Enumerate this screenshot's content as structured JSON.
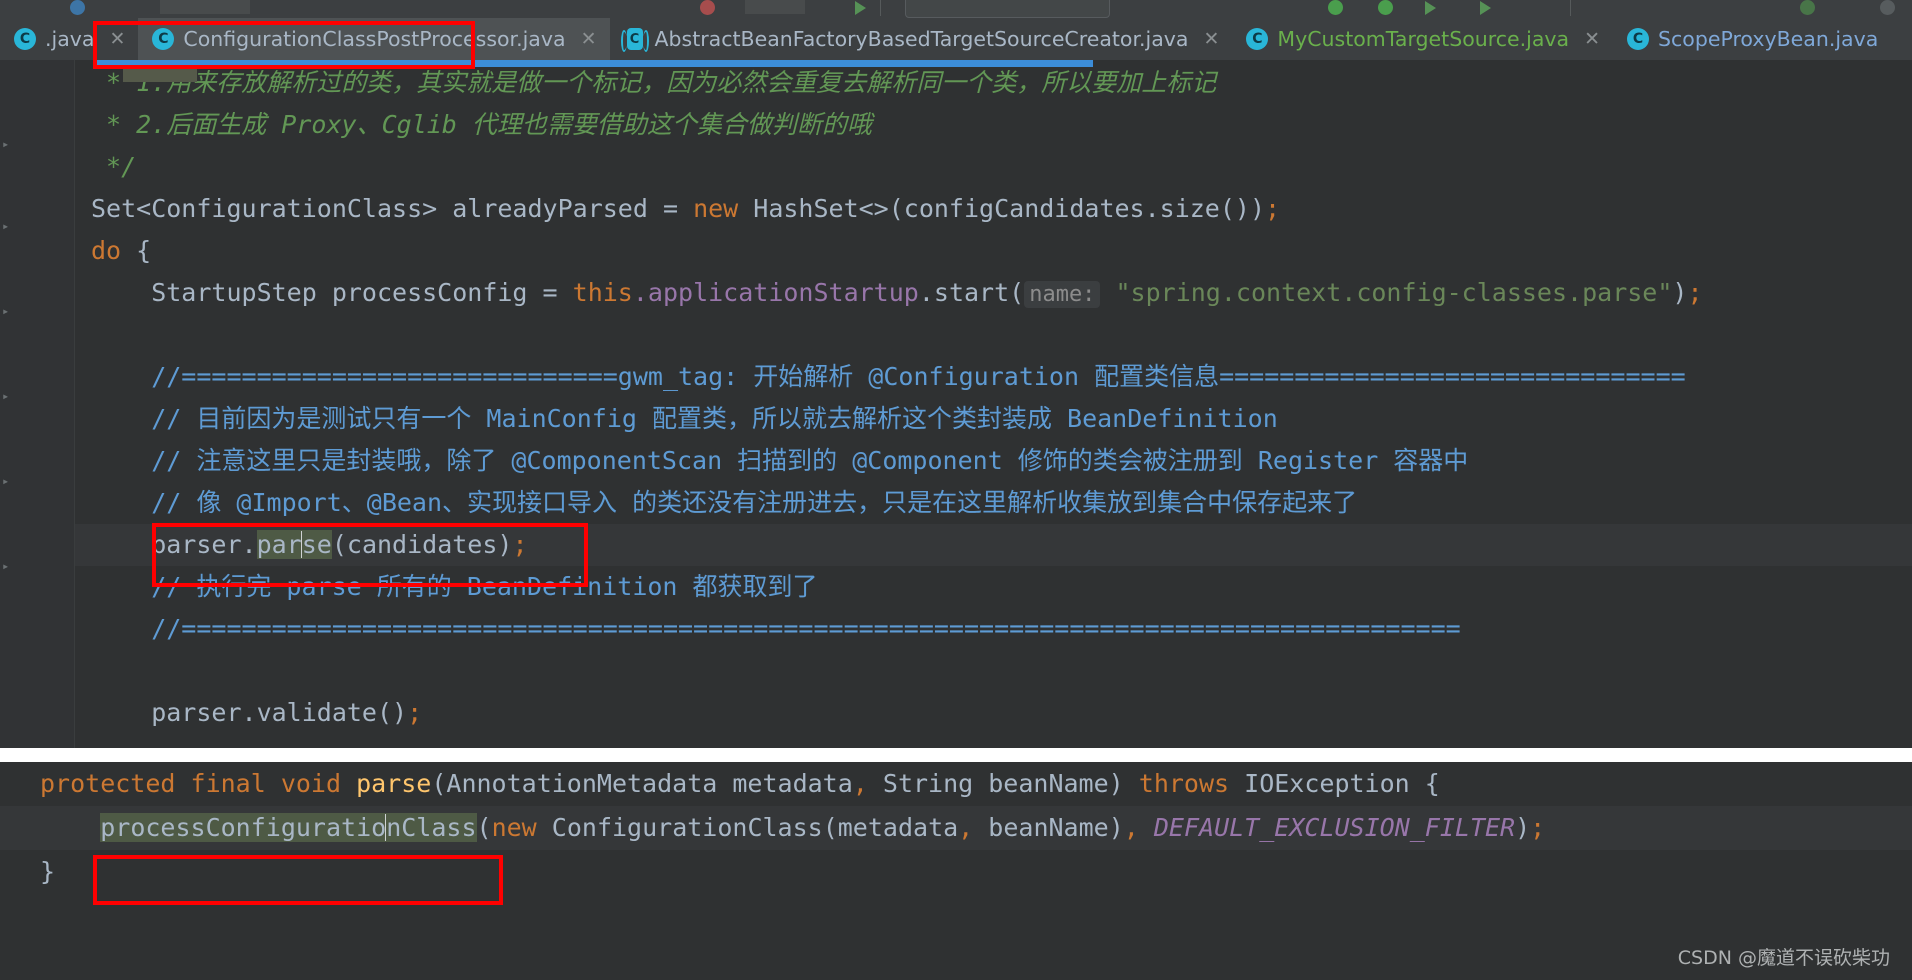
{
  "window": {
    "theme_bg": "#2b2b2b",
    "editor_bg": "#2f3132",
    "tabbar_bg": "#3c3f41",
    "accent_red": "#ff0000",
    "accent_blue": "#3c8dd9"
  },
  "tabs": [
    {
      "label": ".java",
      "icon": "java-class-icon",
      "icon_letter": "C",
      "close": "✕",
      "state": "partial",
      "color": "grey"
    },
    {
      "label": "ConfigurationClassPostProcessor.java",
      "icon": "java-class-icon",
      "icon_letter": "C",
      "close": "✕",
      "state": "active",
      "color": "grey"
    },
    {
      "label": "AbstractBeanFactoryBasedTargetSourceCreator.java",
      "icon": "java-class-outlined-icon",
      "icon_letter": "C",
      "close": "✕",
      "state": "inactive",
      "color": "grey"
    },
    {
      "label": "MyCustomTargetSource.java",
      "icon": "java-class-icon",
      "icon_letter": "C",
      "close": "✕",
      "state": "inactive",
      "color": "green"
    },
    {
      "label": "ScopeProxyBean.java",
      "icon": "java-class-icon",
      "icon_letter": "C",
      "close": "",
      "state": "inactive",
      "color": "blue"
    }
  ],
  "editor_top": {
    "lines": [
      {
        "id": "l1",
        "highlight": false,
        "tokens": [
          {
            "t": " * 1.用来存放解析过的类，其实就是做一个标记，因为必然会重复去解析同一个类，所以要加上标记",
            "c": "cm"
          }
        ]
      },
      {
        "id": "l2",
        "highlight": false,
        "tokens": [
          {
            "t": " * 2.后面生成 Proxy、Cglib 代理也需要借助这个集合做判断的哦",
            "c": "cm"
          }
        ]
      },
      {
        "id": "l3",
        "highlight": false,
        "tokens": [
          {
            "t": " */",
            "c": "cm"
          }
        ]
      },
      {
        "id": "l4",
        "highlight": false,
        "tokens": [
          {
            "t": "Set<ConfigurationClass> alreadyParsed = ",
            "c": "pn"
          },
          {
            "t": "new",
            "c": "k"
          },
          {
            "t": " HashSet<>(configCandidates.size())",
            "c": "pn"
          },
          {
            "t": ";",
            "c": "k"
          }
        ]
      },
      {
        "id": "l5",
        "highlight": false,
        "tokens": [
          {
            "t": "do",
            "c": "k"
          },
          {
            "t": " {",
            "c": "pn"
          }
        ]
      },
      {
        "id": "l6",
        "highlight": false,
        "tokens": [
          {
            "t": "    StartupStep processConfig = ",
            "c": "pn"
          },
          {
            "t": "this",
            "c": "k"
          },
          {
            "t": ".applicationStartup",
            "c": "fi"
          },
          {
            "t": ".start(",
            "c": "pn"
          },
          {
            "t": "name:",
            "c": "hint"
          },
          {
            "t": " ",
            "c": "pn"
          },
          {
            "t": "\"spring.context.config-classes.parse\"",
            "c": "s"
          },
          {
            "t": ")",
            "c": "pn"
          },
          {
            "t": ";",
            "c": "k"
          }
        ]
      },
      {
        "id": "l7",
        "highlight": false,
        "tokens": [
          {
            "t": "",
            "c": "pn"
          }
        ]
      },
      {
        "id": "l8",
        "highlight": false,
        "tokens": [
          {
            "t": "    //=============================gwm_tag: 开始解析 @Configuration 配置类信息===============================",
            "c": "lc"
          }
        ]
      },
      {
        "id": "l9",
        "highlight": false,
        "tokens": [
          {
            "t": "    // 目前因为是测试只有一个 MainConfig 配置类，所以就去解析这个类封装成 BeanDefinition",
            "c": "lc"
          }
        ]
      },
      {
        "id": "l10",
        "highlight": false,
        "tokens": [
          {
            "t": "    // 注意这里只是封装哦，除了 @ComponentScan 扫描到的 @Component 修饰的类会被注册到 Register 容器中",
            "c": "lc"
          }
        ]
      },
      {
        "id": "l11",
        "highlight": false,
        "tokens": [
          {
            "t": "    // 像 @Import、@Bean、实现接口导入 的类还没有注册进去，只是在这里解析收集放到集合中保存起来了",
            "c": "lc"
          }
        ]
      },
      {
        "id": "l12",
        "highlight": true,
        "tokens": [
          {
            "t": "    parser.",
            "c": "pn"
          },
          {
            "t": "par",
            "c": "sel"
          },
          {
            "t": "CARET",
            "c": "caret"
          },
          {
            "t": "se",
            "c": "sel"
          },
          {
            "t": "(candidates)",
            "c": "pn"
          },
          {
            "t": ";",
            "c": "k"
          }
        ]
      },
      {
        "id": "l13",
        "highlight": false,
        "tokens": [
          {
            "t": "    // 执行完 parse 所有的 BeanDefinition 都获取到了",
            "c": "lc"
          }
        ]
      },
      {
        "id": "l14",
        "highlight": false,
        "tokens": [
          {
            "t": "    //=====================================================================================",
            "c": "lc"
          }
        ]
      },
      {
        "id": "l15",
        "highlight": false,
        "tokens": [
          {
            "t": "",
            "c": "pn"
          }
        ]
      },
      {
        "id": "l16",
        "highlight": false,
        "tokens": [
          {
            "t": "    parser.validate()",
            "c": "pn"
          },
          {
            "t": ";",
            "c": "k"
          }
        ]
      }
    ]
  },
  "editor_bottom": {
    "lines": [
      {
        "id": "b1",
        "highlight": false,
        "tokens": [
          {
            "t": "protected final void ",
            "c": "k"
          },
          {
            "t": "parse",
            "c": "meth"
          },
          {
            "t": "(AnnotationMetadata metadata",
            "c": "pn"
          },
          {
            "t": ",",
            "c": "k"
          },
          {
            "t": " String beanName) ",
            "c": "pn"
          },
          {
            "t": "throws",
            "c": "k"
          },
          {
            "t": " IOException {",
            "c": "pn"
          }
        ]
      },
      {
        "id": "b2",
        "highlight": true,
        "tokens": [
          {
            "t": "    ",
            "c": "pn"
          },
          {
            "t": "processConfiguratio",
            "c": "sel"
          },
          {
            "t": "CARET",
            "c": "caret"
          },
          {
            "t": "nClass",
            "c": "sel"
          },
          {
            "t": "(",
            "c": "pn"
          },
          {
            "t": "new",
            "c": "k"
          },
          {
            "t": " ConfigurationClass(metadata",
            "c": "pn"
          },
          {
            "t": ",",
            "c": "k"
          },
          {
            "t": " beanName)",
            "c": "pn"
          },
          {
            "t": ",",
            "c": "k"
          },
          {
            "t": " ",
            "c": "pn"
          },
          {
            "t": "DEFAULT_EXCLUSION_FILTER",
            "c": "st"
          },
          {
            "t": ")",
            "c": "pn"
          },
          {
            "t": ";",
            "c": "k"
          }
        ]
      },
      {
        "id": "b3",
        "highlight": false,
        "tokens": [
          {
            "t": "}",
            "c": "pn"
          }
        ]
      }
    ]
  },
  "annotations": {
    "boxes": [
      {
        "name": "tab-highlight-box",
        "target": "ConfigurationClassPostProcessor.java tab"
      },
      {
        "name": "parser-parse-call-box",
        "target": "parser.parse(candidates);"
      },
      {
        "name": "process-configuration-class-box",
        "target": "processConfigurationClass(new ConfigurationClass(...))"
      }
    ],
    "color": "#ff0000"
  },
  "watermark": {
    "text": "CSDN @魔道不误砍柴功"
  }
}
